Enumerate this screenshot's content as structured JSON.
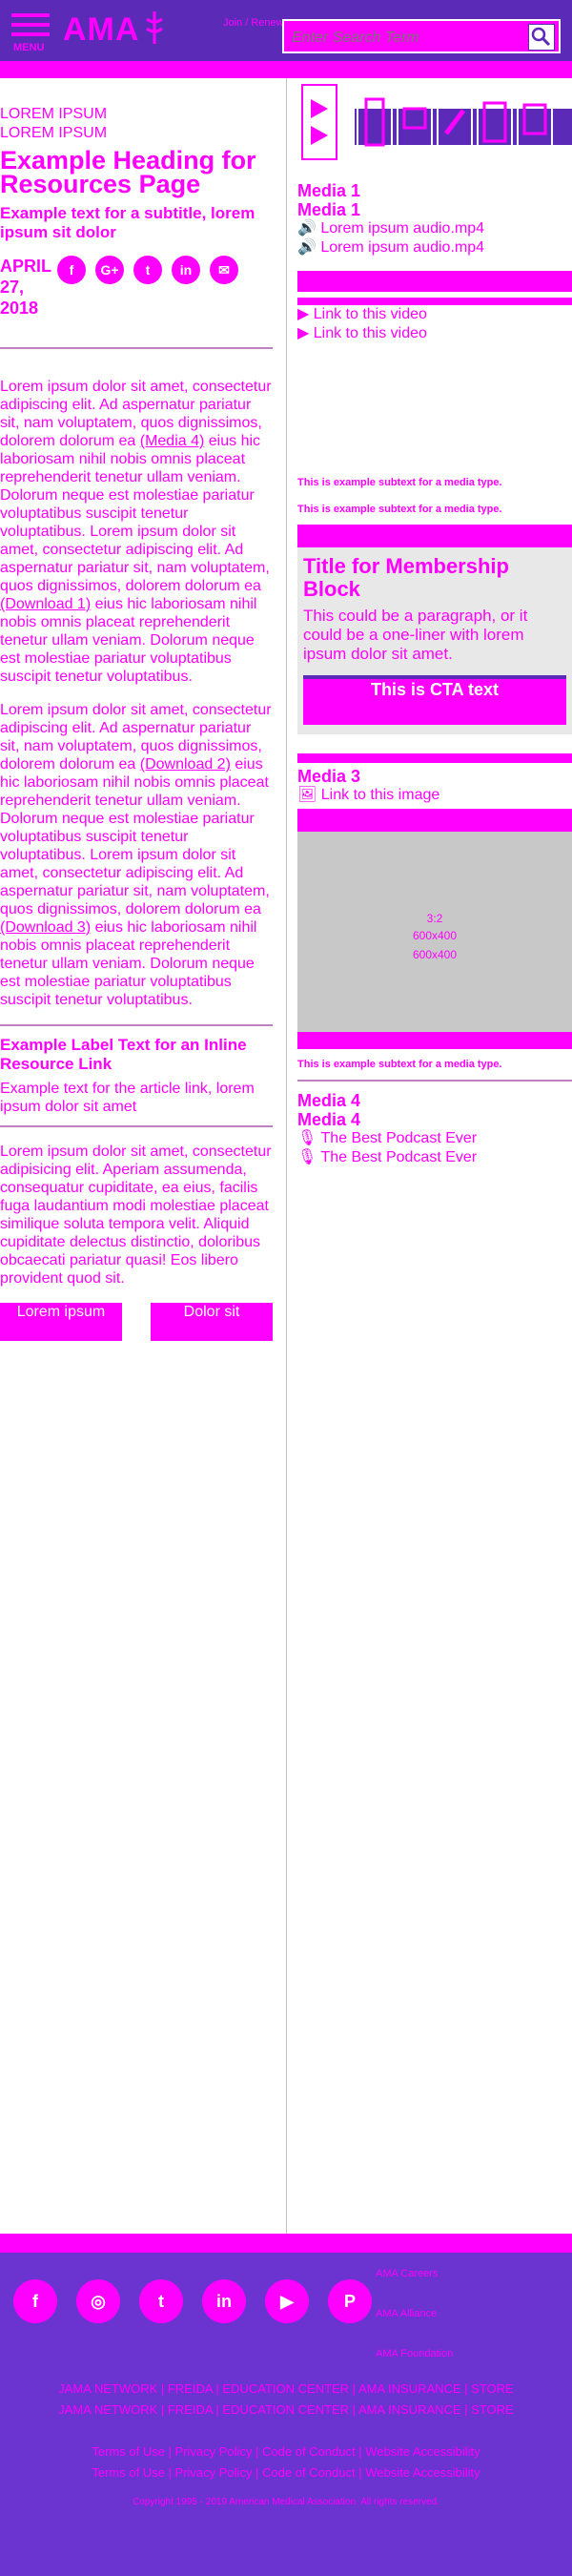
{
  "header": {
    "menu_label": "MENU",
    "logo": "AMA",
    "join_label": "Join / Renew",
    "search_placeholder": "Enter Search Term",
    "colors": {
      "header_bg": "#5b2bb8",
      "accent": "#ff00ff"
    }
  },
  "article": {
    "eyebrow": "LOREM IPSUM",
    "title": "Example Heading for Resources Page",
    "subtitle": "Example text for a subtitle, lorem ipsum sit dolor",
    "date": "APRIL 27, 2018",
    "share_icons": [
      "facebook-icon",
      "google-plus-icon",
      "twitter-icon",
      "linkedin-icon",
      "email-icon"
    ],
    "share_glyphs": [
      "f",
      "G+",
      "t",
      "in",
      "✉"
    ],
    "para1": "Lorem ipsum dolor sit amet, consectetur adipiscing elit. Ad aspernatur pariatur sit, nam voluptatem, quos dignissimos, dolorem dolorum ea ",
    "para1_link": "(Media 4)",
    "para1_rest": " eius hic laboriosam nihil nobis omnis placeat reprehenderit tenetur ullam veniam. Dolorum neque est molestiae pariatur voluptatibus suscipit tenetur voluptatibus. Lorem ipsum dolor sit amet, consectetur adipiscing elit. Ad aspernatur pariatur sit, nam voluptatem, quos dignissimos, dolorem dolorum ea ",
    "para1_link2": "(Download 1)",
    "para1_rest2": " eius hic laboriosam nihil nobis omnis placeat reprehenderit tenetur ullam veniam. Dolorum neque est molestiae pariatur voluptatibus suscipit tenetur voluptatibus.",
    "para2": "Lorem ipsum dolor sit amet, consectetur adipiscing elit. Ad aspernatur pariatur sit, nam voluptatem, quos dignissimos, dolorem dolorum ea ",
    "para2_link": "(Download 2)",
    "para2_rest": " eius hic laboriosam nihil nobis omnis placeat reprehenderit tenetur ullam veniam. Dolorum neque est molestiae pariatur voluptatibus suscipit tenetur voluptatibus. Lorem ipsum dolor sit amet, consectetur adipiscing elit. Ad aspernatur pariatur sit, nam voluptatem, quos dignissimos, dolorem dolorum ea ",
    "para2_link2": "(Download 3)",
    "para2_rest2": " eius hic laboriosam nihil nobis omnis placeat reprehenderit tenetur ullam veniam. Dolorum neque est molestiae pariatur voluptatibus suscipit tenetur voluptatibus.",
    "inline_label": "Example Label Text for an Inline Resource Link",
    "inline_desc": "Example text for the article link, lorem ipsum dolor sit amet",
    "para3": "Lorem ipsum dolor sit amet, consectetur adipisicing elit. Aperiam assumenda, consequatur cupiditate, ea eius, facilis fuga laudantium modi molestiae placeat similique soluta tempora velit. Aliquid cupiditate delectus distinctio, doloribus obcaecati pariatur quasi! Eos libero provident quod sit.",
    "button1": "Lorem ipsum",
    "button2": "Dolor sit"
  },
  "sidebar": {
    "media1_heading": "Media 1",
    "media1_item": "Lorem ipsum audio.mp4",
    "media2_item": "Link to this video",
    "subtext": "This is example subtext for a media type.",
    "member_title": "Title for Membership Block",
    "member_p": "This could be a paragraph, or it could be a one-liner with lorem ipsum dolor sit amet.",
    "cta_label": "This is CTA text",
    "media3_heading": "Media 3",
    "media3_item": "Link to this image",
    "image_ratio": "3:2",
    "image_size": "600x400",
    "media4_heading": "Media 4",
    "media4_item": "The Best Podcast Ever"
  },
  "footer": {
    "social_icons": [
      "facebook-icon",
      "instagram-icon",
      "twitter-icon",
      "linkedin-icon",
      "youtube-icon",
      "pinterest-icon"
    ],
    "social_glyphs": [
      "f",
      "◎",
      "t",
      "in",
      "▶",
      "P"
    ],
    "links": [
      "AMA Careers",
      "AMA Alliance",
      "AMA Foundation"
    ],
    "nav": "JAMA NETWORK | FREIDA | EDUCATION CENTER | AMA INSURANCE | STORE",
    "legal": "Terms of Use | Privacy Policy | Code of Conduct | Website Accessibility",
    "copyright": "Copyright 1995 - 2019 American Medical Association. All rights reserved."
  }
}
